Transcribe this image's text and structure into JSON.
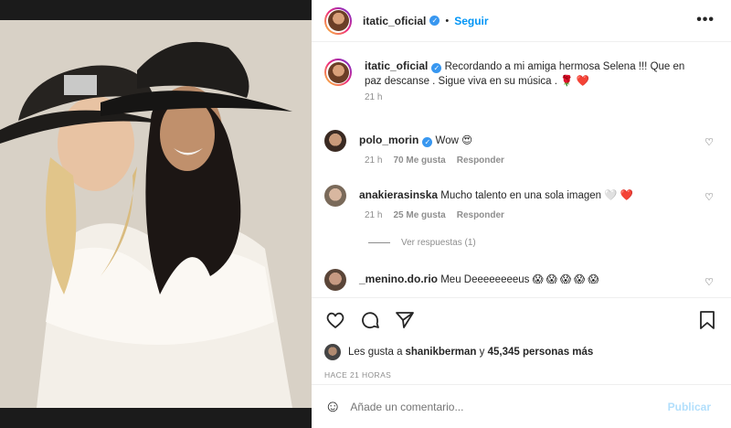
{
  "post": {
    "author": "itatic_oficial",
    "follow_label": "Seguir",
    "more_label": "•••",
    "caption": "Recordando a mi amiga hermosa Selena !!! Que en paz descanse . Sigue viva en su música . 🌹 ❤️",
    "caption_time": "21 h"
  },
  "comments": [
    {
      "user": "polo_morin",
      "verified": true,
      "text": "Wow 😍",
      "time": "21 h",
      "likes": "70 Me gusta",
      "reply": "Responder"
    },
    {
      "user": "anakierasinska",
      "verified": false,
      "text": "Mucho talento en una sola imagen 🤍 ❤️",
      "time": "21 h",
      "likes": "25 Me gusta",
      "reply": "Responder"
    },
    {
      "user": "_menino.do.rio",
      "verified": false,
      "text": "Meu Deeeeeeeeus 😱 😱 😱 😱 😱"
    }
  ],
  "view_replies": "Ver respuestas (1)",
  "likes": {
    "prefix": "Les gusta a ",
    "user": "shanikberman",
    "middle": " y ",
    "count": "45,345 personas más"
  },
  "timestamp": "HACE 21 HORAS",
  "add_comment": {
    "placeholder": "Añade un comentario...",
    "publish_label": "Publicar"
  },
  "colors": {
    "accent": "#0095f6",
    "publish_disabled": "#b2dffc",
    "like_heart": "#ed4956",
    "verified": "#3897f0"
  }
}
